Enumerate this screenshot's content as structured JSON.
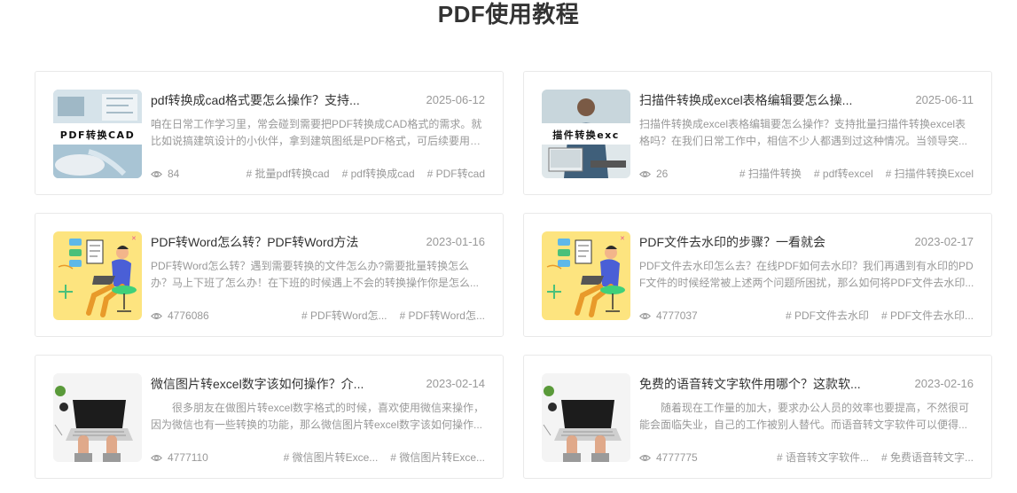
{
  "page_title": "PDF使用教程",
  "articles": [
    {
      "title": "pdf转换成cad格式要怎么操作？支持...",
      "date": "2025-06-12",
      "desc": "咱在日常工作学习里，常会碰到需要把PDF转换成CAD格式的需求。就比如说搞建筑设计的小伙伴，拿到建筑图纸是PDF格式，可后续要用C...",
      "views": "84",
      "tags": [
        "批量pdf转换cad",
        "pdf转换成cad",
        "PDF转cad"
      ],
      "thumb_text": "PDF转换CAD",
      "thumb_icon": "pdf-to-cad-thumbnail"
    },
    {
      "title": "扫描件转换成excel表格编辑要怎么操...",
      "date": "2025-06-11",
      "desc": "扫描件转换成excel表格编辑要怎么操作？支持批量扫描件转换excel表格吗？在我们日常工作中，相信不少人都遇到过这种情况。当领导突...",
      "views": "26",
      "tags": [
        "扫描件转换",
        "pdf转excel",
        "扫描件转换Excel"
      ],
      "thumb_text": "描件转换exc",
      "thumb_icon": "scan-to-excel-thumbnail"
    },
    {
      "title": "PDF转Word怎么转？PDF转Word方法",
      "date": "2023-01-16",
      "desc": "PDF转Word怎么转？遇到需要转换的文件怎么办?需要批量转换怎么办？马上下班了怎么办！在下班的时候遇上不会的转换操作你是怎么...",
      "views": "4776086",
      "tags": [
        "PDF转Word怎...",
        "PDF转Word怎..."
      ],
      "thumb_icon": "office-illustration-thumbnail"
    },
    {
      "title": "PDF文件去水印的步骤？一看就会",
      "date": "2023-02-17",
      "desc": "PDF文件去水印怎么去？在线PDF如何去水印？我们再遇到有水印的PDF文件的时候经常被上述两个问题所困扰，那么如何将PDF文件去水印...",
      "views": "4777037",
      "tags": [
        "PDF文件去水印",
        "PDF文件去水印..."
      ],
      "thumb_icon": "office-illustration-thumbnail"
    },
    {
      "title": "微信图片转excel数字该如何操作？介...",
      "date": "2023-02-14",
      "desc": "很多朋友在做图片转excel数字格式的时候，喜欢使用微信来操作，因为微信也有一些转换的功能，那么微信图片转excel数字该如何操作...",
      "views": "4777110",
      "tags": [
        "微信图片转Exce...",
        "微信图片转Exce..."
      ],
      "thumb_icon": "laptop-typing-thumbnail"
    },
    {
      "title": "免费的语音转文字软件用哪个？这款软...",
      "date": "2023-02-16",
      "desc": "随着现在工作量的加大，要求办公人员的效率也要提高，不然很可能会面临失业，自己的工作被别人替代。而语音转文字软件可以便得...",
      "views": "4777775",
      "tags": [
        "语音转文字软件...",
        "免费语音转文字..."
      ],
      "thumb_icon": "laptop-typing-thumbnail"
    }
  ]
}
